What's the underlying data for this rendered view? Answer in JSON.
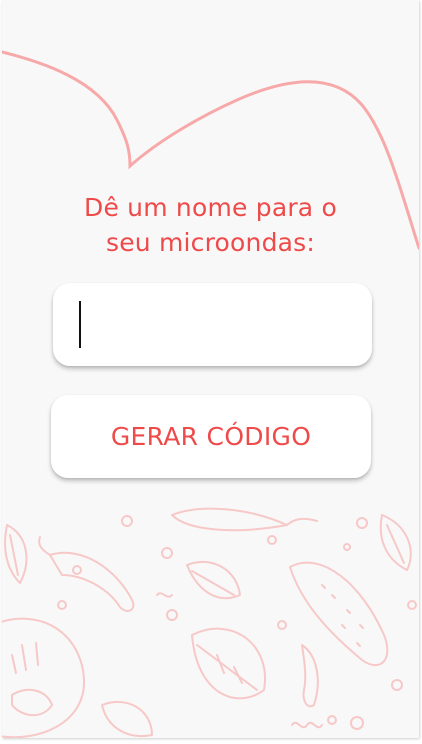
{
  "prompt": {
    "line1": "Dê um nome para o",
    "line2": "seu microondas:"
  },
  "name_input": {
    "value": "",
    "placeholder": ""
  },
  "generate_button": {
    "label": "GERAR CÓDIGO"
  },
  "colors": {
    "accent": "#ef4a4a",
    "curve": "#f7a9a9",
    "doodle": "#f7c8c8",
    "background": "#f8f8f8",
    "surface": "#ffffff"
  },
  "decorations": [
    "heart-outline-curve",
    "vegetable-doodle-pattern"
  ]
}
